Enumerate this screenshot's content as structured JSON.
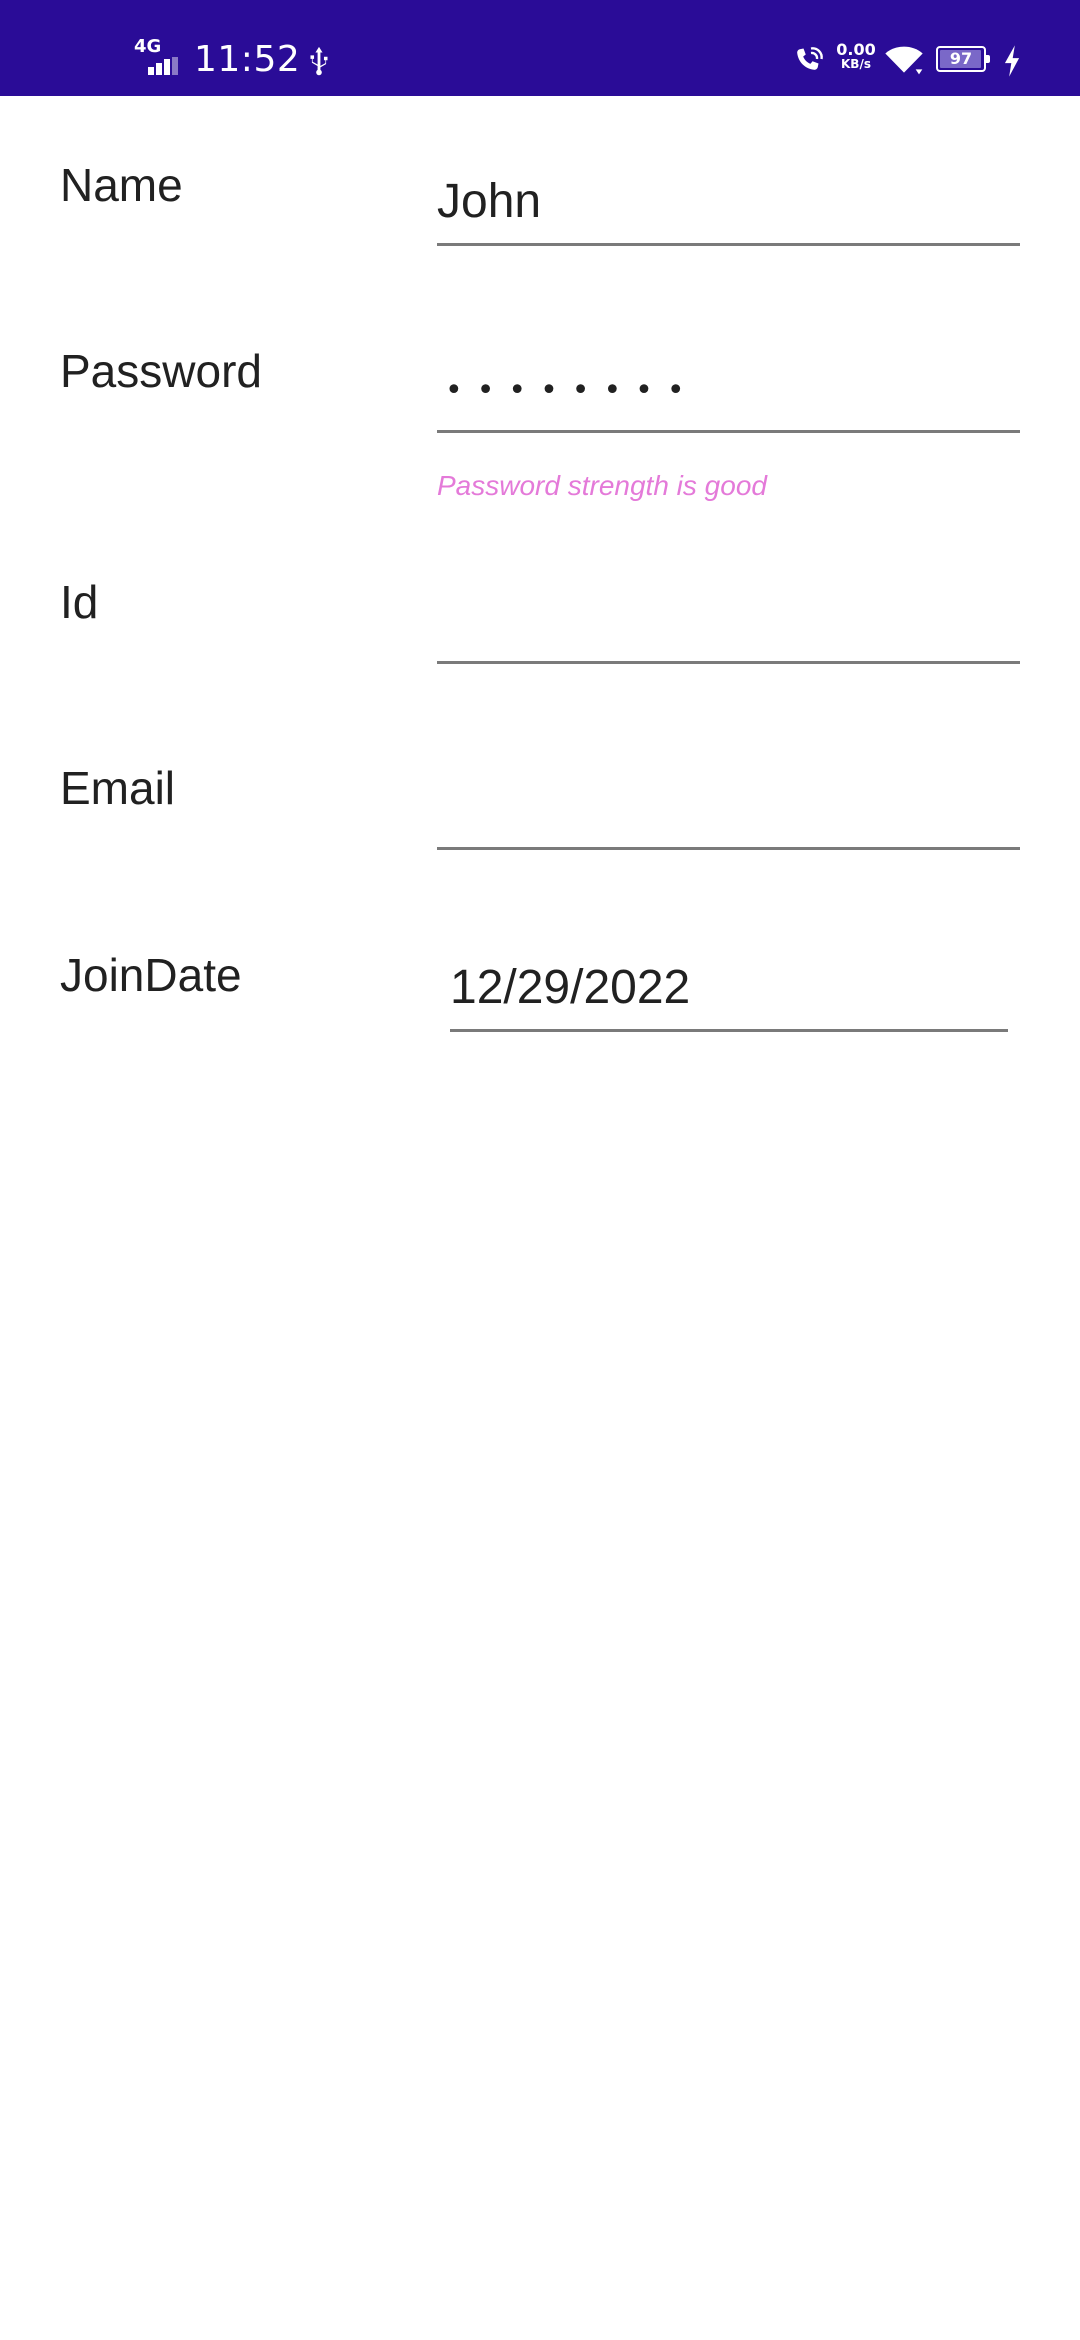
{
  "status_bar": {
    "network": "4G",
    "time": "11:52",
    "speed_value": "0.00",
    "speed_unit": "KB/s",
    "battery_level": "97",
    "battery_fraction": 0.97,
    "icons": [
      "signal-icon",
      "usb-icon",
      "wifi-calling-icon",
      "wifi-icon",
      "battery-icon",
      "charging-icon"
    ],
    "background_color": "#2a0c97"
  },
  "form": {
    "fields": [
      {
        "label": "Name",
        "value": "John"
      },
      {
        "label": "Password",
        "value": "••••••••"
      },
      {
        "label": "Id",
        "value": ""
      },
      {
        "label": "Email",
        "value": ""
      },
      {
        "label": "JoinDate",
        "value": "12/29/2022"
      }
    ],
    "password_hint": "Password strength is good",
    "hint_color": "#e47ad9"
  }
}
